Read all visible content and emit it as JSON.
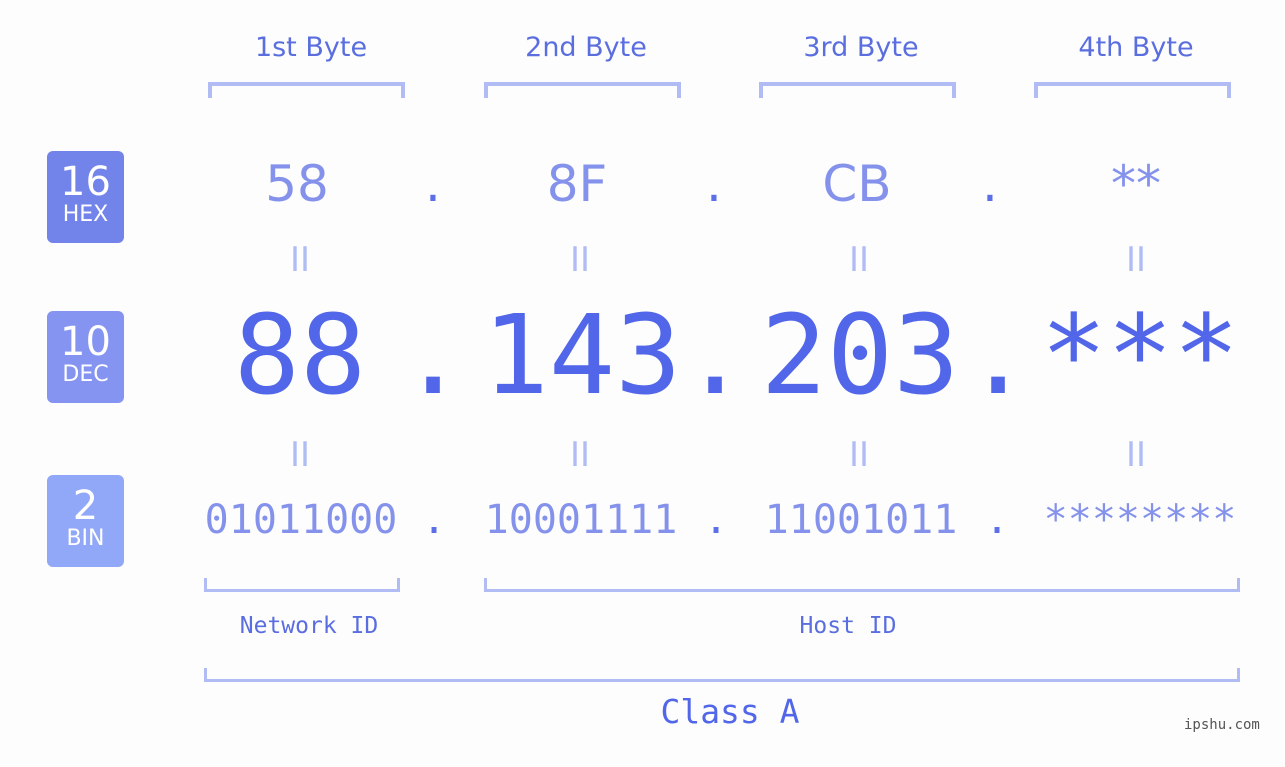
{
  "byte_headers": [
    "1st Byte",
    "2nd Byte",
    "3rd Byte",
    "4th Byte"
  ],
  "badges": {
    "hex": {
      "number": "16",
      "base": "HEX",
      "color": "#7283ea"
    },
    "dec": {
      "number": "10",
      "base": "DEC",
      "color": "#8594f0"
    },
    "bin": {
      "number": "2",
      "base": "BIN",
      "color": "#91a7f7"
    }
  },
  "hex_values": [
    "58",
    "8F",
    "CB",
    "**"
  ],
  "dec_values": [
    "88",
    "143",
    "203",
    "***"
  ],
  "bin_values": [
    "01011000",
    "10001111",
    "11001011",
    "********"
  ],
  "separator": ".",
  "equals_sign": "II",
  "network_label": "Network ID",
  "host_label": "Host ID",
  "class_label": "Class A",
  "watermark": "ipshu.com",
  "colors": {
    "accent": "#5166e8",
    "light": "#8592ec",
    "bracket": "#b1bcf5"
  }
}
